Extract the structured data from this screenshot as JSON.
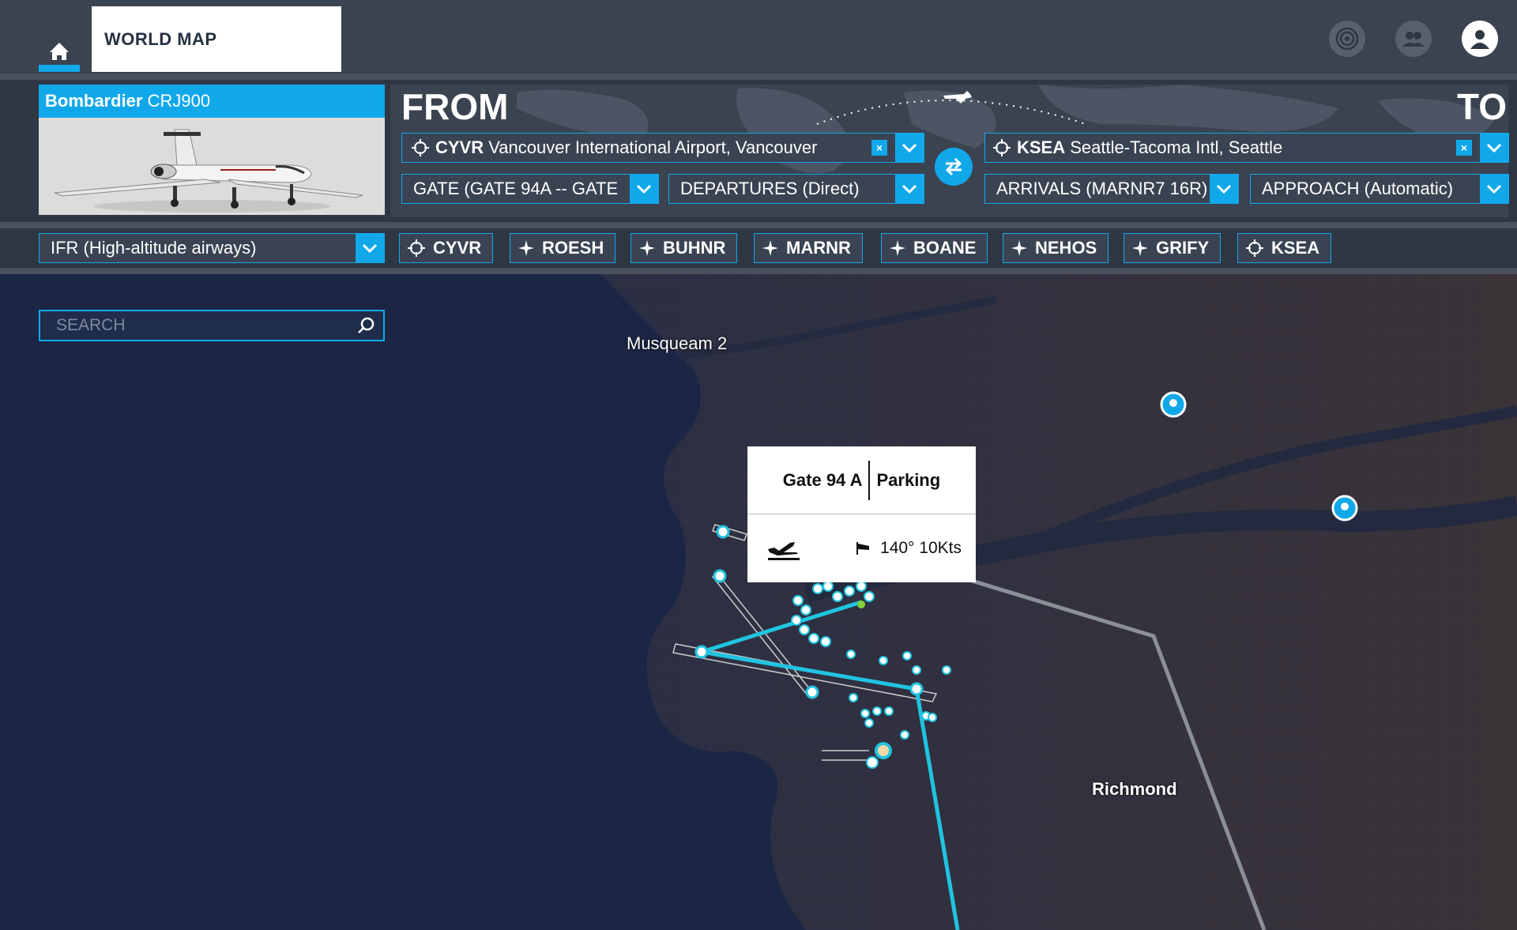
{
  "header": {
    "tab_label": "WORLD MAP",
    "icons": [
      "home-icon",
      "target-icon",
      "friends-icon",
      "profile-icon"
    ]
  },
  "aircraft": {
    "brand": "Bombardier",
    "model": "CRJ900"
  },
  "from": {
    "heading": "FROM",
    "airport_code": "CYVR",
    "airport_name": "Vancouver International Airport, Vancouver",
    "parking": "GATE (GATE 94A -- GATE",
    "procedure": "DEPARTURES (Direct)"
  },
  "to": {
    "heading": "TO",
    "airport_code": "KSEA",
    "airport_name": "Seattle-Tacoma Intl, Seattle",
    "arrival": "ARRIVALS (MARNR7 16R)",
    "approach": "APPROACH (Automatic)"
  },
  "flight_type": "IFR (High-altitude airways)",
  "waypoints": [
    {
      "label": "CYVR",
      "icon": "airport-icon"
    },
    {
      "label": "ROESH",
      "icon": "waypoint-icon"
    },
    {
      "label": "BUHNR",
      "icon": "waypoint-icon"
    },
    {
      "label": "MARNR",
      "icon": "waypoint-icon"
    },
    {
      "label": "BOANE",
      "icon": "waypoint-icon"
    },
    {
      "label": "NEHOS",
      "icon": "waypoint-icon"
    },
    {
      "label": "GRIFY",
      "icon": "waypoint-icon"
    },
    {
      "label": "KSEA",
      "icon": "airport-icon"
    }
  ],
  "search": {
    "placeholder": "SEARCH"
  },
  "map": {
    "labels": {
      "musqueam": "Musqueam 2",
      "richmond": "Richmond"
    }
  },
  "popup": {
    "gate": "Gate 94 A",
    "type": "Parking",
    "wind": "140° 10Kts"
  },
  "colors": {
    "accent": "#11a8ea",
    "route": "#20c4e0",
    "panel": "#2f3644"
  }
}
